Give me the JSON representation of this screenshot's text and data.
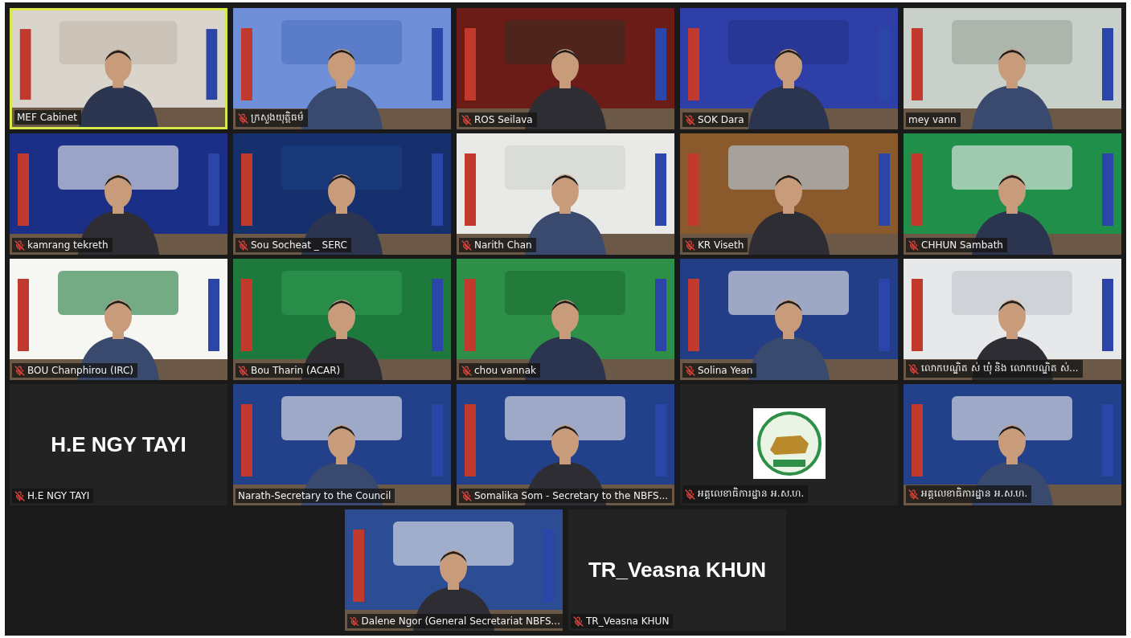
{
  "tiles": [
    {
      "kind": "video",
      "name": "MEF Cabinet",
      "muted": false,
      "selected": true
    },
    {
      "kind": "video",
      "name": "ក្រសួងយុត្តិធម៌",
      "muted": true,
      "selected": false
    },
    {
      "kind": "video",
      "name": "ROS Seilava",
      "muted": true,
      "selected": false
    },
    {
      "kind": "video",
      "name": "SOK Dara",
      "muted": true,
      "selected": false
    },
    {
      "kind": "video",
      "name": "mey vann",
      "muted": false,
      "selected": false
    },
    {
      "kind": "video",
      "name": "kamrang tekreth",
      "muted": true,
      "selected": false
    },
    {
      "kind": "video",
      "name": "Sou Socheat _ SERC",
      "muted": true,
      "selected": false
    },
    {
      "kind": "video",
      "name": "Narith Chan",
      "muted": true,
      "selected": false
    },
    {
      "kind": "video",
      "name": "KR Viseth",
      "muted": true,
      "selected": false
    },
    {
      "kind": "video",
      "name": "CHHUN Sambath",
      "muted": true,
      "selected": false
    },
    {
      "kind": "video",
      "name": "BOU Chanphirou (IRC)",
      "muted": true,
      "selected": false
    },
    {
      "kind": "video",
      "name": "Bou Tharin (ACAR)",
      "muted": true,
      "selected": false
    },
    {
      "kind": "video",
      "name": "chou vannak",
      "muted": true,
      "selected": false
    },
    {
      "kind": "video",
      "name": "Solina Yean",
      "muted": true,
      "selected": false
    },
    {
      "kind": "video",
      "name": "លោកបណ្ឌិត ស់ ឃុំ និង លោកបណ្ឌិត ស់...",
      "muted": true,
      "selected": false
    },
    {
      "kind": "name",
      "display_name": "H.E NGY TAYI",
      "name": "H.E NGY TAYI",
      "muted": true,
      "selected": false
    },
    {
      "kind": "video",
      "name": "Narath-Secretary to the Council",
      "muted": false,
      "selected": false
    },
    {
      "kind": "video",
      "name": "Somalika Som - Secretary to the NBFS...",
      "muted": true,
      "selected": false
    },
    {
      "kind": "logo",
      "name": "អគ្គលេខាធិការដ្ឋាន អ.ស.ហ.",
      "muted": true,
      "selected": false
    },
    {
      "kind": "video",
      "name": "អគ្គលេខាធិការដ្ឋាន អ.ស.ហ.",
      "muted": true,
      "selected": false
    },
    {
      "kind": "video",
      "name": "Dalene Ngor (General Secretariat NBFS...",
      "muted": true,
      "selected": false
    },
    {
      "kind": "name",
      "display_name": "TR_Veasna KHUN",
      "name": "TR_Veasna KHUN",
      "muted": true,
      "selected": false
    }
  ]
}
